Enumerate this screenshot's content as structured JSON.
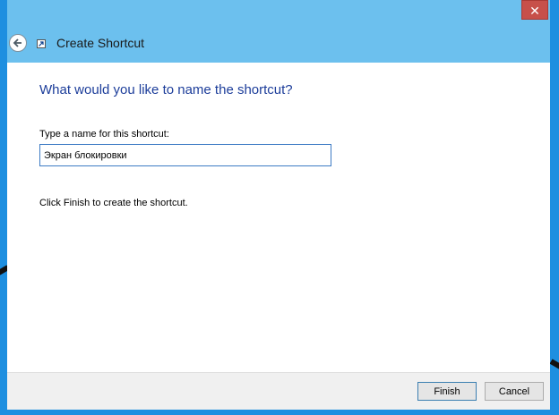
{
  "window": {
    "title": "Create Shortcut",
    "close_label": "✕"
  },
  "content": {
    "heading": "What would you like to name the shortcut?",
    "name_label": "Type a name for this shortcut:",
    "name_value": "Экран блокировки",
    "hint": "Click Finish to create the shortcut."
  },
  "footer": {
    "finish_label": "Finish",
    "cancel_label": "Cancel"
  },
  "icons": {
    "back": "back-arrow-icon",
    "shortcut": "shortcut-icon",
    "close": "close-icon"
  },
  "colors": {
    "titlebar": "#6cc0ee",
    "heading": "#1c3d9a",
    "close": "#c7504a"
  }
}
